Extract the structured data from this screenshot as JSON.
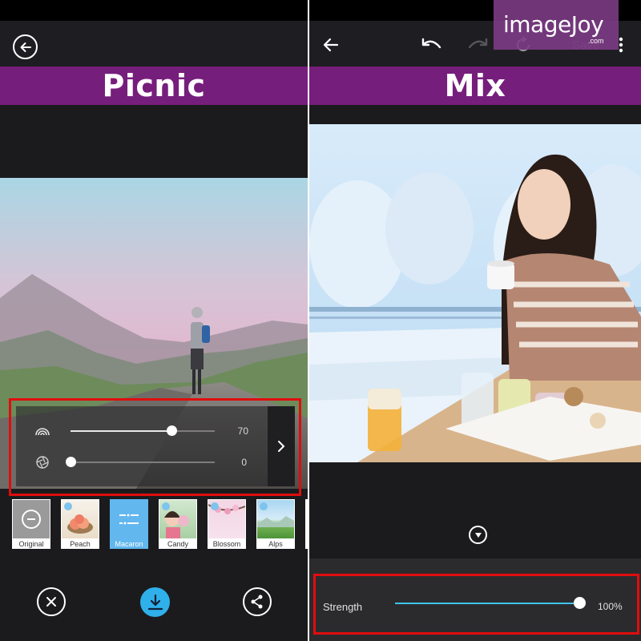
{
  "left": {
    "banner_title": "Picnic",
    "sliders": [
      {
        "icon": "rainbow-icon",
        "value": 70,
        "value_label": "70"
      },
      {
        "icon": "aperture-icon",
        "value": 0,
        "value_label": "0"
      }
    ],
    "filters": [
      {
        "name": "Original",
        "selected": false
      },
      {
        "name": "Peach",
        "selected": false
      },
      {
        "name": "Macaron",
        "selected": true
      },
      {
        "name": "Candy",
        "selected": false
      },
      {
        "name": "Blossom",
        "selected": false
      },
      {
        "name": "Alps",
        "selected": false
      }
    ]
  },
  "right": {
    "banner_title": "Mix",
    "save_label": "Save",
    "strength_label": "Strength",
    "strength_value": 100,
    "strength_value_label": "100%"
  },
  "watermark": {
    "brand": "imageJoy",
    "domain": ".com"
  },
  "colors": {
    "banner": "#761e7c",
    "highlight": "#e00d0d",
    "accent": "#3fc3e8",
    "selected_filter": "#62b7ef"
  }
}
